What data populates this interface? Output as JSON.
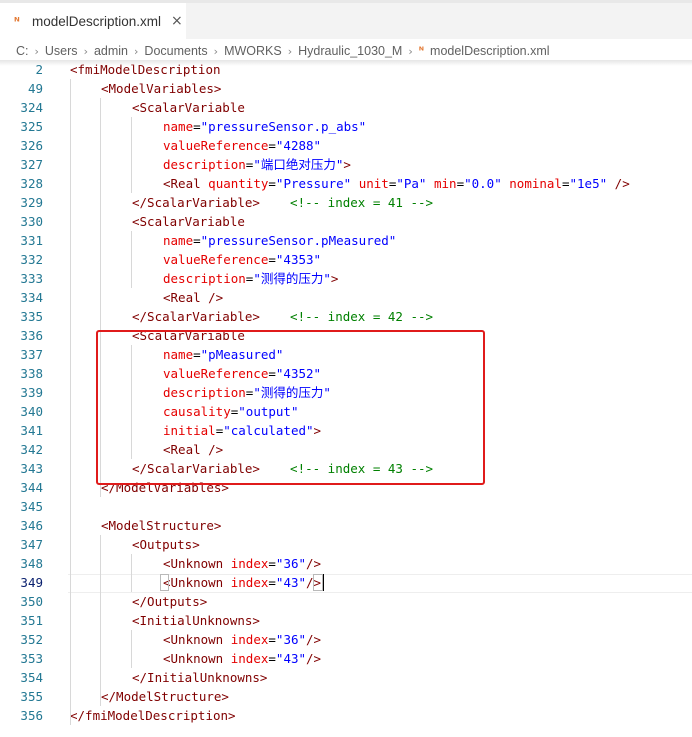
{
  "tab": {
    "icon": "rss-xml-icon",
    "label": "modelDescription.xml",
    "close": "×"
  },
  "breadcrumb": [
    "C:",
    "Users",
    "admin",
    "Documents",
    "MWORKS",
    "Hydraulic_1030_M",
    "modelDescription.xml"
  ],
  "breadcrumb_icon": "ᴺ",
  "colors": {
    "tag": "#800000",
    "attribute": "#e50000",
    "value": "#0000ff",
    "comment": "#008000",
    "line_number": "#237893",
    "highlight": "#e01b1b"
  },
  "active_line": "349",
  "lines": [
    {
      "n": "2",
      "i": 0,
      "t": [
        [
          "<fmiModelDescription",
          "tag"
        ]
      ]
    },
    {
      "n": "49",
      "i": 1,
      "t": [
        [
          "<ModelVariables>",
          "tag"
        ]
      ]
    },
    {
      "n": "324",
      "i": 2,
      "t": [
        [
          "<ScalarVariable",
          "tag"
        ]
      ]
    },
    {
      "n": "325",
      "i": 3,
      "t": [
        [
          "name",
          "attr"
        ],
        [
          "=",
          ""
        ],
        [
          "\"pressureSensor.p_abs\"",
          "val"
        ]
      ]
    },
    {
      "n": "326",
      "i": 3,
      "t": [
        [
          "valueReference",
          "attr"
        ],
        [
          "=",
          ""
        ],
        [
          "\"4288\"",
          "val"
        ]
      ]
    },
    {
      "n": "327",
      "i": 3,
      "t": [
        [
          "description",
          "attr"
        ],
        [
          "=",
          ""
        ],
        [
          "\"端口绝对压力\"",
          "val"
        ],
        [
          ">",
          "tag"
        ]
      ]
    },
    {
      "n": "328",
      "i": 3,
      "t": [
        [
          "<Real",
          "tag"
        ],
        [
          " ",
          ""
        ],
        [
          "quantity",
          "attr"
        ],
        [
          "=",
          ""
        ],
        [
          "\"Pressure\"",
          "val"
        ],
        [
          " ",
          ""
        ],
        [
          "unit",
          "attr"
        ],
        [
          "=",
          ""
        ],
        [
          "\"Pa\"",
          "val"
        ],
        [
          " ",
          ""
        ],
        [
          "min",
          "attr"
        ],
        [
          "=",
          ""
        ],
        [
          "\"0.0\"",
          "val"
        ],
        [
          " ",
          ""
        ],
        [
          "nominal",
          "attr"
        ],
        [
          "=",
          ""
        ],
        [
          "\"1e5\"",
          "val"
        ],
        [
          " ",
          ""
        ],
        [
          "/>",
          "tag"
        ]
      ]
    },
    {
      "n": "329",
      "i": 2,
      "t": [
        [
          "</ScalarVariable>",
          "tag"
        ],
        [
          "    ",
          ""
        ],
        [
          "<!-- index = 41 -->",
          "cmt"
        ]
      ]
    },
    {
      "n": "330",
      "i": 2,
      "t": [
        [
          "<ScalarVariable",
          "tag"
        ]
      ]
    },
    {
      "n": "331",
      "i": 3,
      "t": [
        [
          "name",
          "attr"
        ],
        [
          "=",
          ""
        ],
        [
          "\"pressureSensor.pMeasured\"",
          "val"
        ]
      ]
    },
    {
      "n": "332",
      "i": 3,
      "t": [
        [
          "valueReference",
          "attr"
        ],
        [
          "=",
          ""
        ],
        [
          "\"4353\"",
          "val"
        ]
      ]
    },
    {
      "n": "333",
      "i": 3,
      "t": [
        [
          "description",
          "attr"
        ],
        [
          "=",
          ""
        ],
        [
          "\"测得的压力\"",
          "val"
        ],
        [
          ">",
          "tag"
        ]
      ]
    },
    {
      "n": "334",
      "i": 3,
      "t": [
        [
          "<Real />",
          "tag"
        ]
      ]
    },
    {
      "n": "335",
      "i": 2,
      "t": [
        [
          "</ScalarVariable>",
          "tag"
        ],
        [
          "    ",
          ""
        ],
        [
          "<!-- index = 42 -->",
          "cmt"
        ]
      ]
    },
    {
      "n": "336",
      "i": 2,
      "t": [
        [
          "<ScalarVariable",
          "tag"
        ]
      ]
    },
    {
      "n": "337",
      "i": 3,
      "t": [
        [
          "name",
          "attr"
        ],
        [
          "=",
          ""
        ],
        [
          "\"pMeasured\"",
          "val"
        ]
      ]
    },
    {
      "n": "338",
      "i": 3,
      "t": [
        [
          "valueReference",
          "attr"
        ],
        [
          "=",
          ""
        ],
        [
          "\"4352\"",
          "val"
        ]
      ]
    },
    {
      "n": "339",
      "i": 3,
      "t": [
        [
          "description",
          "attr"
        ],
        [
          "=",
          ""
        ],
        [
          "\"测得的压力\"",
          "val"
        ]
      ]
    },
    {
      "n": "340",
      "i": 3,
      "t": [
        [
          "causality",
          "attr"
        ],
        [
          "=",
          ""
        ],
        [
          "\"output\"",
          "val"
        ]
      ]
    },
    {
      "n": "341",
      "i": 3,
      "t": [
        [
          "initial",
          "attr"
        ],
        [
          "=",
          ""
        ],
        [
          "\"calculated\"",
          "val"
        ],
        [
          ">",
          "tag"
        ]
      ]
    },
    {
      "n": "342",
      "i": 3,
      "t": [
        [
          "<Real />",
          "tag"
        ]
      ]
    },
    {
      "n": "343",
      "i": 2,
      "t": [
        [
          "</ScalarVariable>",
          "tag"
        ],
        [
          "    ",
          ""
        ],
        [
          "<!-- index = 43 -->",
          "cmt"
        ]
      ]
    },
    {
      "n": "344",
      "i": 1,
      "t": [
        [
          "</ModelVariables>",
          "tag"
        ]
      ]
    },
    {
      "n": "345",
      "i": 0,
      "t": []
    },
    {
      "n": "346",
      "i": 1,
      "t": [
        [
          "<ModelStructure>",
          "tag"
        ]
      ]
    },
    {
      "n": "347",
      "i": 2,
      "t": [
        [
          "<Outputs>",
          "tag"
        ]
      ]
    },
    {
      "n": "348",
      "i": 3,
      "t": [
        [
          "<Unknown",
          "tag"
        ],
        [
          " ",
          ""
        ],
        [
          "index",
          "attr"
        ],
        [
          "=",
          ""
        ],
        [
          "\"36\"",
          "val"
        ],
        [
          "/>",
          "tag"
        ]
      ]
    },
    {
      "n": "349",
      "i": 3,
      "t": [
        [
          "<Unknown",
          "tag"
        ],
        [
          " ",
          ""
        ],
        [
          "index",
          "attr"
        ],
        [
          "=",
          ""
        ],
        [
          "\"43\"",
          "val"
        ],
        [
          "/>",
          "tag"
        ]
      ]
    },
    {
      "n": "350",
      "i": 2,
      "t": [
        [
          "</Outputs>",
          "tag"
        ]
      ]
    },
    {
      "n": "351",
      "i": 2,
      "t": [
        [
          "<InitialUnknowns>",
          "tag"
        ]
      ]
    },
    {
      "n": "352",
      "i": 3,
      "t": [
        [
          "<Unknown",
          "tag"
        ],
        [
          " ",
          ""
        ],
        [
          "index",
          "attr"
        ],
        [
          "=",
          ""
        ],
        [
          "\"36\"",
          "val"
        ],
        [
          "/>",
          "tag"
        ]
      ]
    },
    {
      "n": "353",
      "i": 3,
      "t": [
        [
          "<Unknown",
          "tag"
        ],
        [
          " ",
          ""
        ],
        [
          "index",
          "attr"
        ],
        [
          "=",
          ""
        ],
        [
          "\"43\"",
          "val"
        ],
        [
          "/>",
          "tag"
        ]
      ]
    },
    {
      "n": "354",
      "i": 2,
      "t": [
        [
          "</InitialUnknowns>",
          "tag"
        ]
      ]
    },
    {
      "n": "355",
      "i": 1,
      "t": [
        [
          "</ModelStructure>",
          "tag"
        ]
      ]
    },
    {
      "n": "356",
      "i": 0,
      "t": [
        [
          "</fmiModelDescription>",
          "tag"
        ]
      ]
    }
  ]
}
